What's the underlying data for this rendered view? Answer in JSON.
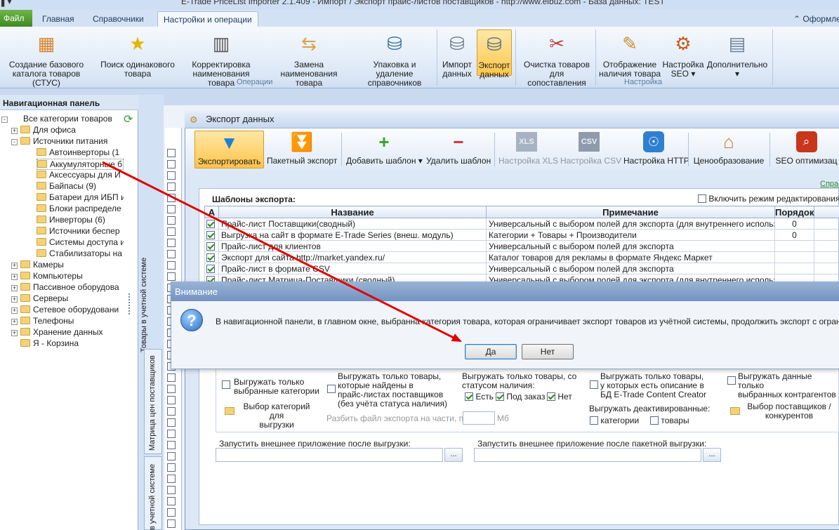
{
  "window": {
    "title": "E-Trade PriceList Importer 2.1.409  -  Импорт / Экспорт прайс-листов поставщиков  -  http://www.elbuz.com  -  База данных: TEST"
  },
  "ribbon": {
    "tabs": [
      "Файл",
      "Главная",
      "Справочники",
      "Настройки и операции"
    ],
    "right_link": "Оформле",
    "buttons": [
      {
        "label": "Создание базового\nкаталога товаров (СТУС)",
        "icon": "cubes-icon"
      },
      {
        "label": "Поиск одинакового\nтовара",
        "icon": "search-star-icon"
      },
      {
        "label": "Корректировка\nнаименования товара",
        "icon": "book-icon"
      },
      {
        "label": "Замена наименования\nтовара",
        "icon": "replace-icon"
      },
      {
        "label": "Упаковка и удаление\nсправочников",
        "icon": "database-icon"
      },
      {
        "label": "Импорт\nданных",
        "icon": "import-icon"
      },
      {
        "label": "Экспорт\nданных",
        "icon": "export-icon"
      },
      {
        "label": "Очистка товаров\nдля сопоставления",
        "icon": "broom-icon"
      },
      {
        "label": "Отображение\nналичия товара",
        "icon": "pencil-icon"
      },
      {
        "label": "Настройка\nSEO ▾",
        "icon": "seo-icon"
      },
      {
        "label": "Дополнительно\n▾",
        "icon": "document-icon"
      }
    ],
    "groups": [
      "Операции",
      "Настройка"
    ]
  },
  "nav": {
    "title": "Навигационная панель",
    "items": [
      {
        "label": "Все категории товаров",
        "level": 0,
        "pm": "-"
      },
      {
        "label": "Для офиса",
        "level": 1,
        "pm": "+"
      },
      {
        "label": "Источники питания",
        "level": 1,
        "pm": "-"
      },
      {
        "label": "Автоинверторы (1",
        "level": 2,
        "pm": ""
      },
      {
        "label": "Аккумуляторные б",
        "level": 2,
        "pm": ""
      },
      {
        "label": "Аксессуары для И",
        "level": 2,
        "pm": ""
      },
      {
        "label": "Байпасы (9)",
        "level": 2,
        "pm": ""
      },
      {
        "label": "Батареи для ИБП и",
        "level": 2,
        "pm": ""
      },
      {
        "label": "Блоки распределе",
        "level": 2,
        "pm": ""
      },
      {
        "label": "Инверторы (6)",
        "level": 2,
        "pm": ""
      },
      {
        "label": "Источники беспер",
        "level": 2,
        "pm": ""
      },
      {
        "label": "Системы доступа и",
        "level": 2,
        "pm": ""
      },
      {
        "label": "Стабилизаторы на",
        "level": 2,
        "pm": ""
      },
      {
        "label": "Камеры",
        "level": 1,
        "pm": "+"
      },
      {
        "label": "Компьютеры",
        "level": 1,
        "pm": "+"
      },
      {
        "label": "Пассивное оборудова",
        "level": 1,
        "pm": "+"
      },
      {
        "label": "Серверы",
        "level": 1,
        "pm": "+"
      },
      {
        "label": "Сетевое оборудовани",
        "level": 1,
        "pm": "+"
      },
      {
        "label": "Телефоны",
        "level": 1,
        "pm": "+"
      },
      {
        "label": "Хранение данных",
        "level": 1,
        "pm": "+"
      },
      {
        "label": "Я - Корзина",
        "level": 1,
        "pm": ""
      }
    ]
  },
  "vtabs": {
    "goods": "Товары в учетной системе",
    "matrix": "Матрица цен поставщиков",
    "goods2": "в учетной системе"
  },
  "grid": {
    "header": "В"
  },
  "export": {
    "title": "Экспорт данных",
    "toolbar": [
      {
        "label": "Экспортировать",
        "icon": "funnel-icon",
        "state": "active"
      },
      {
        "label": "Пакетный экспорт",
        "icon": "double-funnel-icon",
        "state": "normal"
      },
      {
        "label": "Добавить шаблон ▾",
        "icon": "plus-icon",
        "state": "normal"
      },
      {
        "label": "Удалить шаблон",
        "icon": "minus-icon",
        "state": "normal"
      },
      {
        "label": "Настройка XLS",
        "icon": "xls-icon",
        "state": "disabled"
      },
      {
        "label": "Настройка CSV",
        "icon": "csv-icon",
        "state": "disabled"
      },
      {
        "label": "Настройка HTTP",
        "icon": "http-icon",
        "state": "normal"
      },
      {
        "label": "Ценообразование",
        "icon": "house-icon",
        "state": "normal"
      },
      {
        "label": "SEO оптимизац",
        "icon": "seo-web-icon",
        "state": "normal"
      }
    ],
    "spr_link": "Справ",
    "templates_label": "Шаблоны экспорта:",
    "edit_mode_label": "Включить режим редактирования",
    "table": {
      "headers": [
        "А",
        "Название",
        "Примечание",
        "Порядок"
      ],
      "rows": [
        {
          "name": "Прайс-лист Поставщики(сводный)",
          "note": "Универсальный с выбором полей для экспорта (для внутреннего использования",
          "order": "0"
        },
        {
          "name": "Выгрузка на сайт в формате E-Trade Series (внеш. модуль)",
          "note": "Категории + Товары + Производители",
          "order": "0"
        },
        {
          "name": "Прайс-лист для клиентов",
          "note": "Универсальный с выбором полей для экспорта",
          "order": ""
        },
        {
          "name": "Экспорт для сайта http://market.yandex.ru/",
          "note": "Каталог товаров для рекламы в формате Яндекс Маркет",
          "order": ""
        },
        {
          "name": "Прайс-лист в формате CSV",
          "note": "Универсальный с выбором полей для экспорта",
          "order": ""
        },
        {
          "name": "Прайс-лист Матрица-Поставщики (сводный)",
          "note": "Универсальный с выбором полей для экспорта (для внутреннего использования",
          "order": ""
        }
      ]
    },
    "options": {
      "only_selected_categories": "Выгружать только\nвыбранные категории",
      "select_categories": "Выбор категорий для\nвыгрузки",
      "only_found_in_pricelists": "Выгружать только товары,\nкоторые найдены в\nпрайс-листах поставщиков\n(без учёта статуса наличия)",
      "split_file_label": "Разбить файл экспорта на части, по:",
      "split_unit": "Мб",
      "availability_label": "Выгружать только товары, со\nстатусом наличия:",
      "avail_yes": "Есть",
      "avail_order": "Под заказ",
      "avail_no": "Нет",
      "with_description": "Выгружать только товары,\nу которых есть описание в\nБД E-Trade Content Creator",
      "deactivated_label": "Выгружать деактивированные:",
      "deact_categories": "категории",
      "deact_goods": "товары",
      "selected_contractors": "Выгружать данные только\nвыбранных контрагентов",
      "select_suppliers": "Выбор поставщиков /\nконкурентов"
    },
    "run_after_export": "Запустить внешнее приложение после выгрузки:",
    "run_after_batch": "Запустить внешнее приложение после пакетной выгрузки:",
    "browse": "..."
  },
  "dialog": {
    "title": "Внимание",
    "message": "В навигационной панели, в главном окне, выбранна категория товара, которая ограничивает экспорт товаров из учётной системы, продолжить экспорт с ограниченным спи",
    "yes": "Да",
    "no": "Нет"
  },
  "colors": {
    "accent_orange": "#ffc74a",
    "arrow": "#e00000",
    "file_tab": "#3d8a1f"
  }
}
